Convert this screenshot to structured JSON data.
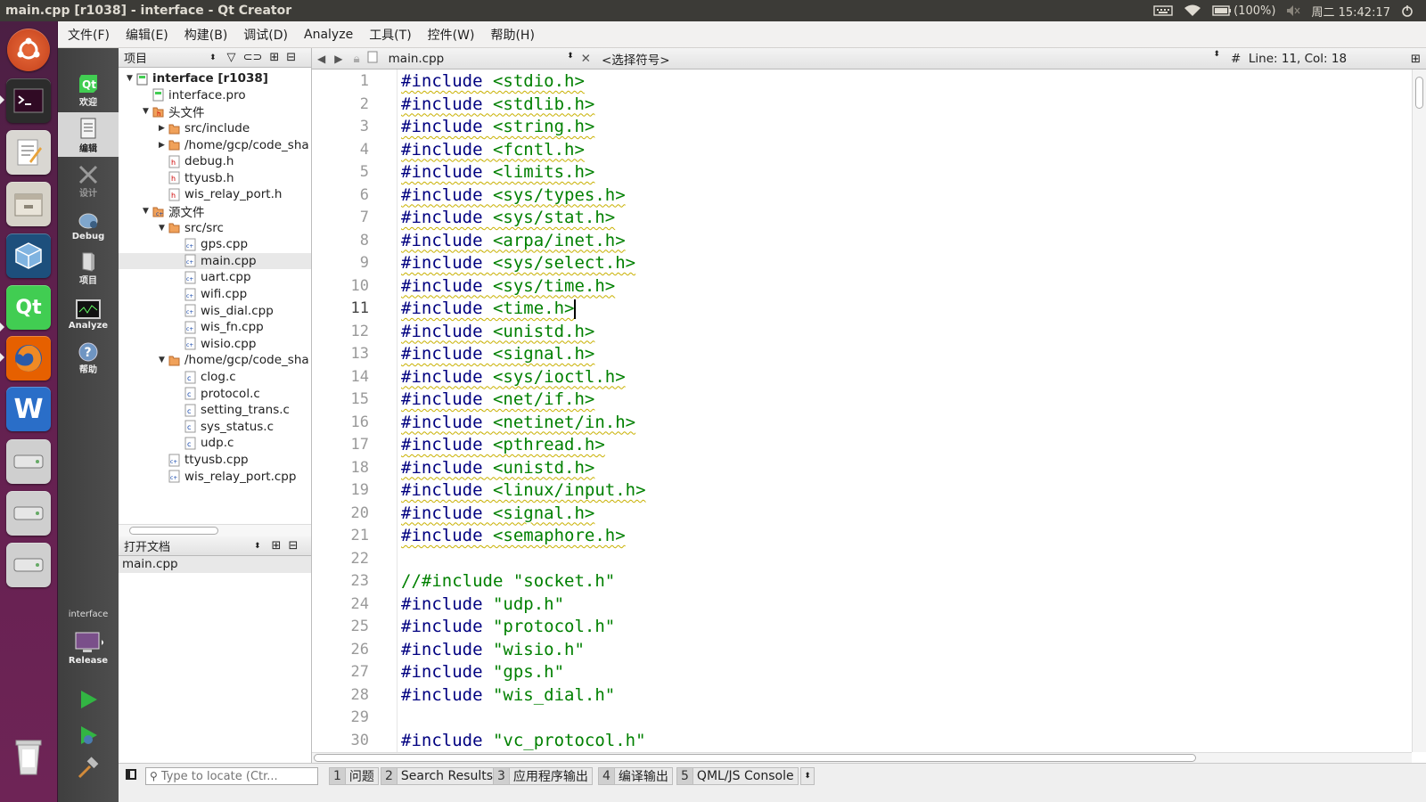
{
  "window": {
    "title": "main.cpp [r1038] - interface - Qt Creator"
  },
  "tray": {
    "battery": "(100%)",
    "clock": "周二 15:42:17"
  },
  "menu": [
    "文件(F)",
    "编辑(E)",
    "构建(B)",
    "调试(D)",
    "Analyze",
    "工具(T)",
    "控件(W)",
    "帮助(H)"
  ],
  "modes": {
    "welcome": "欢迎",
    "edit": "编辑",
    "design": "设计",
    "debug": "Debug",
    "projects": "项目",
    "analyze": "Analyze",
    "help": "帮助"
  },
  "kit": {
    "project": "interface",
    "config": "Release"
  },
  "projects_pane": {
    "title": "项目"
  },
  "tree": [
    {
      "label": "interface [r1038]",
      "depth": 0,
      "icon": "project-icon",
      "arrow": "down",
      "bold": true
    },
    {
      "label": "interface.pro",
      "depth": 1,
      "icon": "pro-file-icon",
      "arrow": ""
    },
    {
      "label": "头文件",
      "depth": 1,
      "icon": "headers-folder-icon",
      "arrow": "down"
    },
    {
      "label": "src/include",
      "depth": 2,
      "icon": "folder-icon",
      "arrow": "right"
    },
    {
      "label": "/home/gcp/code_sha",
      "depth": 2,
      "icon": "folder-icon",
      "arrow": "right"
    },
    {
      "label": "debug.h",
      "depth": 2,
      "icon": "h-file-icon",
      "arrow": ""
    },
    {
      "label": "ttyusb.h",
      "depth": 2,
      "icon": "h-file-icon",
      "arrow": ""
    },
    {
      "label": "wis_relay_port.h",
      "depth": 2,
      "icon": "h-file-icon",
      "arrow": ""
    },
    {
      "label": "源文件",
      "depth": 1,
      "icon": "sources-folder-icon",
      "arrow": "down"
    },
    {
      "label": "src/src",
      "depth": 2,
      "icon": "folder-icon",
      "arrow": "down"
    },
    {
      "label": "gps.cpp",
      "depth": 3,
      "icon": "cpp-file-icon",
      "arrow": ""
    },
    {
      "label": "main.cpp",
      "depth": 3,
      "icon": "cpp-file-icon",
      "arrow": "",
      "selected": true
    },
    {
      "label": "uart.cpp",
      "depth": 3,
      "icon": "cpp-file-icon",
      "arrow": ""
    },
    {
      "label": "wifi.cpp",
      "depth": 3,
      "icon": "cpp-file-icon",
      "arrow": ""
    },
    {
      "label": "wis_dial.cpp",
      "depth": 3,
      "icon": "cpp-file-icon",
      "arrow": ""
    },
    {
      "label": "wis_fn.cpp",
      "depth": 3,
      "icon": "cpp-file-icon",
      "arrow": ""
    },
    {
      "label": "wisio.cpp",
      "depth": 3,
      "icon": "cpp-file-icon",
      "arrow": ""
    },
    {
      "label": "/home/gcp/code_sha",
      "depth": 2,
      "icon": "folder-icon",
      "arrow": "down"
    },
    {
      "label": "clog.c",
      "depth": 3,
      "icon": "c-file-icon",
      "arrow": ""
    },
    {
      "label": "protocol.c",
      "depth": 3,
      "icon": "c-file-icon",
      "arrow": ""
    },
    {
      "label": "setting_trans.c",
      "depth": 3,
      "icon": "c-file-icon",
      "arrow": ""
    },
    {
      "label": "sys_status.c",
      "depth": 3,
      "icon": "c-file-icon",
      "arrow": ""
    },
    {
      "label": "udp.c",
      "depth": 3,
      "icon": "c-file-icon",
      "arrow": ""
    },
    {
      "label": "ttyusb.cpp",
      "depth": 2,
      "icon": "cpp-file-icon",
      "arrow": ""
    },
    {
      "label": "wis_relay_port.cpp",
      "depth": 2,
      "icon": "cpp-file-icon",
      "arrow": ""
    }
  ],
  "open_docs": {
    "title": "打开文档",
    "items": [
      "main.cpp"
    ]
  },
  "editor": {
    "file": "main.cpp",
    "symbol": "<选择符号>",
    "position": "Line: 11, Col: 18",
    "current_line": 11
  },
  "code": [
    {
      "n": "1",
      "kw": "#include",
      "arg": " <stdio.h>",
      "sq": true
    },
    {
      "n": "2",
      "kw": "#include",
      "arg": " <stdlib.h>",
      "sq": true
    },
    {
      "n": "3",
      "kw": "#include",
      "arg": " <string.h>",
      "sq": true
    },
    {
      "n": "4",
      "kw": "#include",
      "arg": " <fcntl.h>",
      "sq": true
    },
    {
      "n": "5",
      "kw": "#include",
      "arg": " <limits.h>",
      "sq": true
    },
    {
      "n": "6",
      "kw": "#include",
      "arg": " <sys/types.h>",
      "sq": true
    },
    {
      "n": "7",
      "kw": "#include",
      "arg": " <sys/stat.h>",
      "sq": true
    },
    {
      "n": "8",
      "kw": "#include",
      "arg": " <arpa/inet.h>",
      "sq": true
    },
    {
      "n": "9",
      "kw": "#include",
      "arg": " <sys/select.h>",
      "sq": true
    },
    {
      "n": "10",
      "kw": "#include",
      "arg": " <sys/time.h>",
      "sq": true
    },
    {
      "n": "11",
      "kw": "#include",
      "arg": " <time.h>",
      "sq": true
    },
    {
      "n": "12",
      "kw": "#include",
      "arg": " <unistd.h>",
      "sq": true
    },
    {
      "n": "13",
      "kw": "#include",
      "arg": " <signal.h>",
      "sq": true
    },
    {
      "n": "14",
      "kw": "#include",
      "arg": " <sys/ioctl.h>",
      "sq": true
    },
    {
      "n": "15",
      "kw": "#include",
      "arg": " <net/if.h>",
      "sq": true
    },
    {
      "n": "16",
      "kw": "#include",
      "arg": " <netinet/in.h>",
      "sq": true
    },
    {
      "n": "17",
      "kw": "#include",
      "arg": " <pthread.h>",
      "sq": true
    },
    {
      "n": "18",
      "kw": "#include",
      "arg": " <unistd.h>",
      "sq": true
    },
    {
      "n": "19",
      "kw": "#include",
      "arg": " <linux/input.h>",
      "sq": true
    },
    {
      "n": "20",
      "kw": "#include",
      "arg": " <signal.h>",
      "sq": true
    },
    {
      "n": "21",
      "kw": "#include",
      "arg": " <semaphore.h>",
      "sq": true
    },
    {
      "n": "22",
      "kw": "",
      "arg": "",
      "sq": false
    },
    {
      "n": "23",
      "kw": "",
      "arg": "//#include \"socket.h\"",
      "sq": false,
      "comment": true
    },
    {
      "n": "24",
      "kw": "#include",
      "arg": " \"udp.h\"",
      "sq": false
    },
    {
      "n": "25",
      "kw": "#include",
      "arg": " \"protocol.h\"",
      "sq": false
    },
    {
      "n": "26",
      "kw": "#include",
      "arg": " \"wisio.h\"",
      "sq": false
    },
    {
      "n": "27",
      "kw": "#include",
      "arg": " \"gps.h\"",
      "sq": false
    },
    {
      "n": "28",
      "kw": "#include",
      "arg": " \"wis_dial.h\"",
      "sq": false
    },
    {
      "n": "29",
      "kw": "",
      "arg": "",
      "sq": false
    },
    {
      "n": "30",
      "kw": "#include",
      "arg": " \"vc_protocol.h\"",
      "sq": false
    }
  ],
  "locator": {
    "placeholder": "Type to locate (Ctr..."
  },
  "output_tabs": [
    {
      "num": "1",
      "label": "问题"
    },
    {
      "num": "2",
      "label": "Search Results"
    },
    {
      "num": "3",
      "label": "应用程序输出"
    },
    {
      "num": "4",
      "label": "编译输出"
    },
    {
      "num": "5",
      "label": "QML/JS Console"
    }
  ],
  "colors": {
    "keyword": "#000080",
    "include": "#008000",
    "launcher": "#62204f",
    "topbar": "#3c3b37"
  }
}
